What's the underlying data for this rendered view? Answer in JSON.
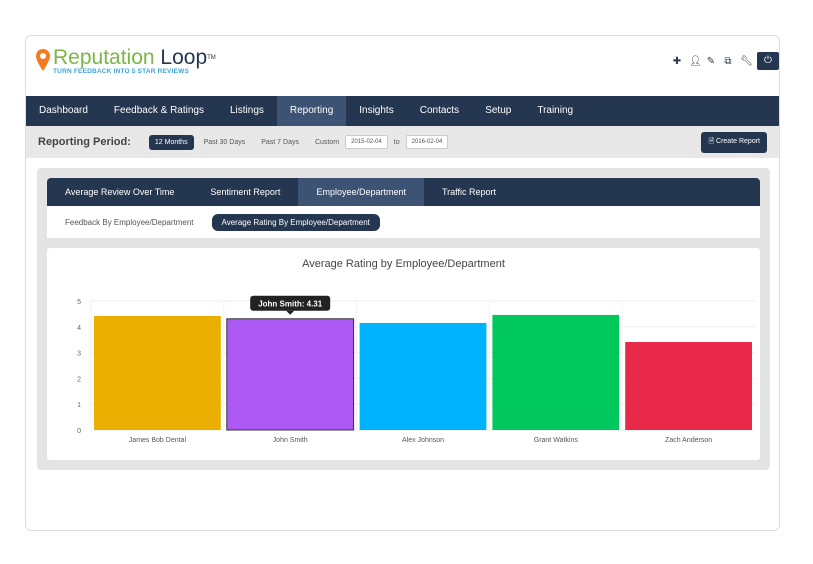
{
  "brand": {
    "name_part1": "Reputation",
    "name_part2": "Loop",
    "tm": "TM",
    "tagline": "TURN FEEDBACK INTO 5 STAR REVIEWS"
  },
  "header_icons": [
    "plus-icon",
    "user-icon",
    "edit-icon",
    "external-link-icon",
    "wrench-icon",
    "power-icon"
  ],
  "nav": [
    "Dashboard",
    "Feedback & Ratings",
    "Listings",
    "Reporting",
    "Insights",
    "Contacts",
    "Setup",
    "Training"
  ],
  "nav_active": "Reporting",
  "period": {
    "label": "Reporting Period:",
    "selected": "12 Months",
    "options": [
      "Past 30 Days",
      "Past 7 Days"
    ],
    "custom": "Custom",
    "from": "2015-02-04",
    "to_label": "to",
    "to": "2016-02-04",
    "create": "Create Report"
  },
  "tabs": [
    "Average Review Over Time",
    "Sentiment Report",
    "Employee/Department",
    "Traffic Report"
  ],
  "subtabs": [
    "Feedback By Employee/Department",
    "Average Rating By Employee/Department"
  ],
  "chart_data": {
    "type": "bar",
    "title": "Average Rating by Employee/Department",
    "categories": [
      "James Bob Dental",
      "John Smith",
      "Alex Johnson",
      "Grant Watkins",
      "Zach Anderson"
    ],
    "values": [
      4.42,
      4.31,
      4.15,
      4.46,
      3.41
    ],
    "colors": [
      "#eaaf00",
      "#ad5af5",
      "#00b3fe",
      "#00c85c",
      "#e8294a"
    ],
    "ylim": [
      0,
      5
    ],
    "yticks": [
      "0",
      "1",
      "2",
      "3",
      "4",
      "5"
    ],
    "grid": true,
    "tooltip": "John Smith: 4.31"
  }
}
